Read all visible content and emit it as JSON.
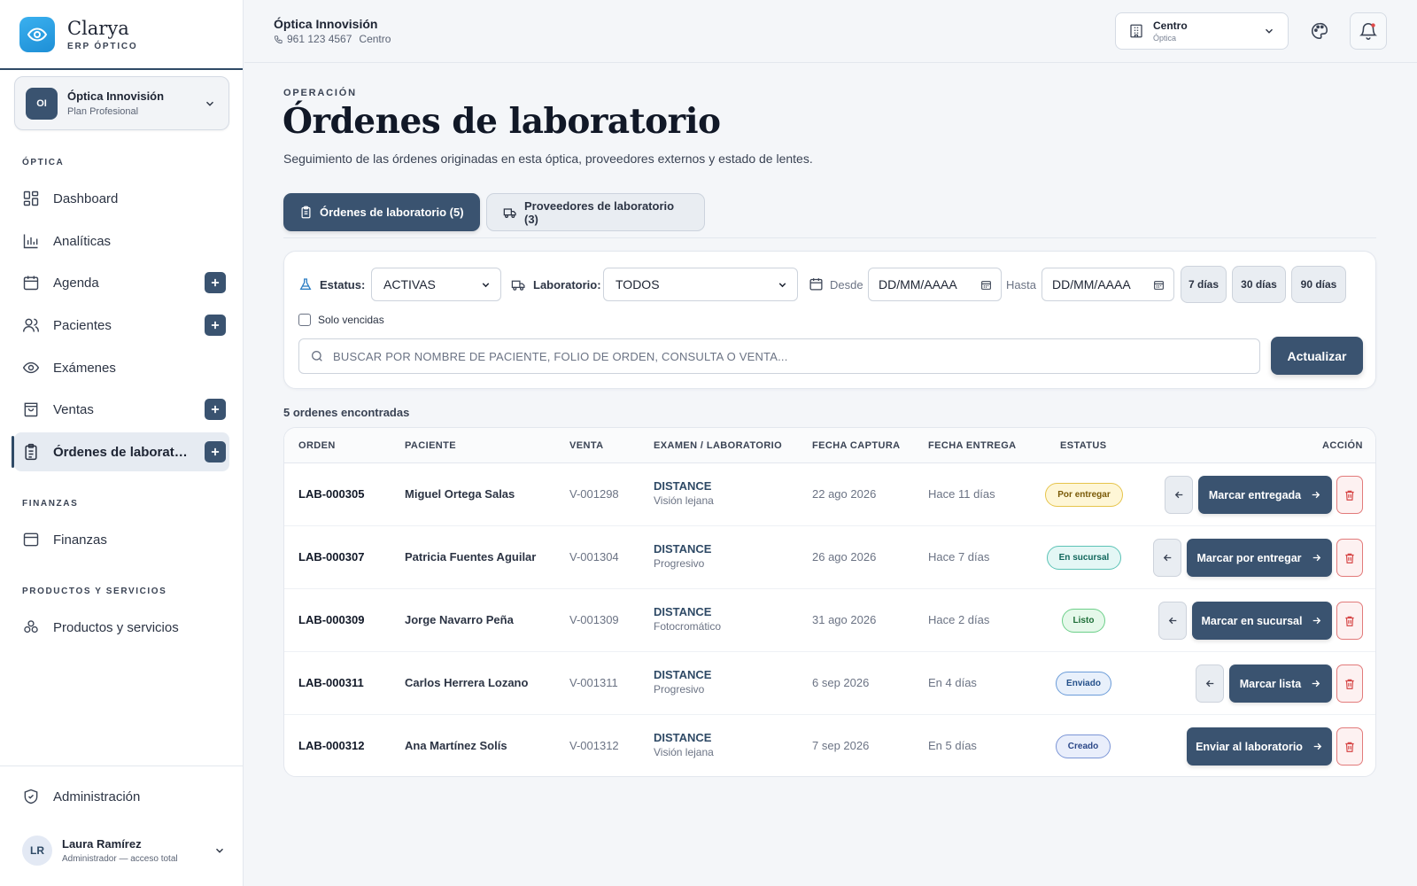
{
  "brand": {
    "name": "Clarya",
    "subtitle": "ERP ÓPTICO"
  },
  "org": {
    "initials": "OI",
    "name": "Óptica Innovisión",
    "plan": "Plan Profesional"
  },
  "sidebar": {
    "section_optica": "ÓPTICA",
    "section_finanzas": "FINANZAS",
    "section_productos": "PRODUCTOS Y SERVICIOS",
    "items": [
      {
        "label": "Dashboard"
      },
      {
        "label": "Analíticas"
      },
      {
        "label": "Agenda"
      },
      {
        "label": "Pacientes"
      },
      {
        "label": "Exámenes"
      },
      {
        "label": "Ventas"
      },
      {
        "label": "Órdenes de laboratorio"
      },
      {
        "label": "Finanzas"
      },
      {
        "label": "Productos y servicios"
      },
      {
        "label": "Administración"
      }
    ]
  },
  "user": {
    "initials": "LR",
    "name": "Laura Ramírez",
    "role": "Administrador — acceso total"
  },
  "topbar": {
    "name": "Óptica Innovisión",
    "phone": "961 123 4567",
    "location": "Centro",
    "branch_name": "Centro",
    "branch_sub": "Óptica"
  },
  "page": {
    "eyebrow": "OPERACIÓN",
    "title": "Órdenes de laboratorio",
    "description": "Seguimiento de las órdenes originadas en esta óptica, proveedores externos y estado de lentes."
  },
  "tabs": [
    {
      "label": "Órdenes de laboratorio (5)"
    },
    {
      "label": "Proveedores de laboratorio (3)"
    }
  ],
  "filters": {
    "status_label": "Estatus:",
    "status_value": "ACTIVAS",
    "lab_label": "Laboratorio:",
    "lab_value": "TODOS",
    "from_label": "Desde",
    "from_placeholder": "DD/MM/AAAA",
    "to_label": "Hasta",
    "to_placeholder": "DD/MM/AAAA",
    "chips": [
      "7 días",
      "30 días",
      "90 días"
    ],
    "overdue_label": "Solo vencidas",
    "search_placeholder": "BUSCAR POR NOMBRE DE PACIENTE, FOLIO DE ORDEN, CONSULTA O VENTA...",
    "update_label": "Actualizar"
  },
  "results_count": "5 ordenes encontradas",
  "table": {
    "columns": [
      "ORDEN",
      "PACIENTE",
      "VENTA",
      "EXAMEN / LABORATORIO",
      "FECHA CAPTURA",
      "FECHA ENTREGA",
      "ESTATUS",
      "ACCIÓN"
    ],
    "rows": [
      {
        "order": "LAB-000305",
        "patient": "Miguel Ortega Salas",
        "sale": "V-001298",
        "lab": "DISTANCE",
        "lens": "Visión lejana",
        "captured": "22 ago 2026",
        "delivery": "Hace 11 días",
        "status": "Por entregar",
        "action": "Marcar entregada"
      },
      {
        "order": "LAB-000307",
        "patient": "Patricia Fuentes Aguilar",
        "sale": "V-001304",
        "lab": "DISTANCE",
        "lens": "Progresivo",
        "captured": "26 ago 2026",
        "delivery": "Hace 7 días",
        "status": "En sucursal",
        "action": "Marcar por entregar"
      },
      {
        "order": "LAB-000309",
        "patient": "Jorge Navarro Peña",
        "sale": "V-001309",
        "lab": "DISTANCE",
        "lens": "Fotocromático",
        "captured": "31 ago 2026",
        "delivery": "Hace 2 días",
        "status": "Listo",
        "action": "Marcar en sucursal"
      },
      {
        "order": "LAB-000311",
        "patient": "Carlos Herrera Lozano",
        "sale": "V-001311",
        "lab": "DISTANCE",
        "lens": "Progresivo",
        "captured": "6 sep 2026",
        "delivery": "En 4 días",
        "status": "Enviado",
        "action": "Marcar lista"
      },
      {
        "order": "LAB-000312",
        "patient": "Ana Martínez Solís",
        "sale": "V-001312",
        "lab": "DISTANCE",
        "lens": "Visión lejana",
        "captured": "7 sep 2026",
        "delivery": "En 5 días",
        "status": "Creado",
        "action": "Enviar al laboratorio"
      }
    ]
  },
  "colors": {
    "primary": "#3a5370",
    "brand": "#1e8fd6",
    "danger": "#d64545"
  }
}
